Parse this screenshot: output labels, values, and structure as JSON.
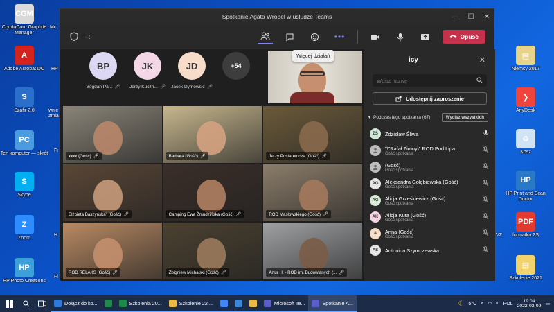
{
  "desktop_left": [
    {
      "label": "CryptoCard Graphite Manager",
      "icon": "cgm-icon",
      "color": "#d9d9d9",
      "text": "CGM"
    },
    {
      "label": "Adobe Acrobat DC",
      "icon": "acrobat-icon",
      "color": "#d4221c",
      "text": "A"
    },
    {
      "label": "Szafir 2.0",
      "icon": "szafir-icon",
      "color": "#2a6fc9",
      "text": "S"
    },
    {
      "label": "Ten komputer — skrót",
      "icon": "computer-icon",
      "color": "#4b9be0",
      "text": "PC"
    },
    {
      "label": "Skype",
      "icon": "skype-icon",
      "color": "#00aff0",
      "text": "S"
    },
    {
      "label": "Zoom",
      "icon": "zoom-icon",
      "color": "#2d8cff",
      "text": "Z"
    },
    {
      "label": "HP Photo Creations",
      "icon": "hp-photo-icon",
      "color": "#3ea0d8",
      "text": "HP"
    }
  ],
  "desktop_partial": [
    "Mc",
    "HP",
    "wnic zmia",
    "Fi",
    "H",
    "Fi",
    "V",
    "VZ"
  ],
  "desktop_right": [
    {
      "label": "Niemcy 2017",
      "icon": "archive-icon",
      "color": "#e8d38a",
      "text": "▤"
    },
    {
      "label": "AnyDesk",
      "icon": "anydesk-icon",
      "color": "#ef443b",
      "text": "❯"
    },
    {
      "label": "Kosz",
      "icon": "recycle-bin-icon",
      "color": "#cfe3f5",
      "text": "♻"
    },
    {
      "label": "HP Print and Scan Doctor",
      "icon": "hp-doctor-icon",
      "color": "#2a79c9",
      "text": "HP"
    },
    {
      "label": "formatka ZS",
      "icon": "pdf-icon",
      "color": "#e33a2f",
      "text": "PDF"
    },
    {
      "label": "Szkolenie 2021",
      "icon": "folder-zip-icon",
      "color": "#f2d36b",
      "text": "▤"
    }
  ],
  "window": {
    "title": "Spotkanie Agata Wróbel w usłudze Teams",
    "timer": "--:--",
    "leave_label": "Opuść",
    "tooltip": "Więcej działań"
  },
  "pinned": [
    {
      "initials": "BP",
      "name": "Bogdan Pa...",
      "color": "#dcd7f2"
    },
    {
      "initials": "JK",
      "name": "Jerzy Kuczn...",
      "color": "#f4d7e6"
    },
    {
      "initials": "JD",
      "name": "Jacek Dymowski",
      "color": "#f6dcc9"
    },
    {
      "initials": "+54",
      "name": "",
      "color": "#3d3d3d"
    }
  ],
  "tiles": [
    {
      "name": "xxxx (Gość)",
      "bg": "#8a8478"
    },
    {
      "name": "Barbara (Gość)",
      "bg": "#c7b78e"
    },
    {
      "name": "Jerzy Postaremcza (Gość)",
      "bg": "#6b5a3a"
    },
    {
      "name": "Elżbieta Baszyńska\" (Gość)",
      "bg": "#5a4636"
    },
    {
      "name": "Camping Ewa Żmudzińska (Gość)",
      "bg": "#3a2e28"
    },
    {
      "name": "ROD Masłowskiego (Gość)",
      "bg": "#8b7d6a"
    },
    {
      "name": "ROD RELAKS (Gość)",
      "bg": "#b98a63"
    },
    {
      "name": "Zbigniew Michalski (Gość)",
      "bg": "#4b4130"
    },
    {
      "name": "Artur H. - ROD im. Budowlanych (...",
      "bg": "#9fa1a3"
    }
  ],
  "panel": {
    "title": "icy",
    "search_placeholder": "Wpisz nazwę",
    "share_label": "Udostępnij zaproszenie",
    "section_label": "Podczas tego spotkania (67)",
    "mute_all_label": "Wycisz wszystkich",
    "participants": [
      {
        "initials": "ZŚ",
        "name": "Zdzisław Śliwa",
        "role": "",
        "color": "#cfe8d8"
      },
      {
        "initials": "",
        "name": "\"\\\"Rafał Zimny\\\" ROD Pod Lipa...",
        "role": "Gość spotkania",
        "color": "#bdbdbd"
      },
      {
        "initials": "",
        "name": "(Gość)",
        "role": "Gość spotkania",
        "color": "#bdbdbd"
      },
      {
        "initials": "AG",
        "name": "Aleksandra Gołębiewska (Gość)",
        "role": "Gość spotkania",
        "color": "#e4e4e4"
      },
      {
        "initials": "AG",
        "name": "Alicja Grześkiewicz (Gość)",
        "role": "Gość spotkania",
        "color": "#d6ecd5"
      },
      {
        "initials": "AK",
        "name": "Alicja Kuta (Gość)",
        "role": "Gość spotkania",
        "color": "#f5d2e2"
      },
      {
        "initials": "A",
        "name": "Anna (Gość)",
        "role": "Gość spotkania",
        "color": "#f6dcc9"
      },
      {
        "initials": "AS",
        "name": "Antonina Szymczewska",
        "role": "",
        "color": "#e4e4e4"
      }
    ]
  },
  "taskbar": {
    "items": [
      {
        "label": "Dołącz do ko...",
        "color": "#2f7ad8"
      },
      {
        "label": "",
        "color": "#1f8a4c"
      },
      {
        "label": "Szkolenia 20...",
        "color": "#1f8a4c"
      },
      {
        "label": "Szkolenie 22 ...",
        "color": "#e9b84a"
      },
      {
        "label": "",
        "color": "#4285f4"
      },
      {
        "label": "",
        "color": "#3a86d8"
      },
      {
        "label": "",
        "color": "#e9b84a"
      },
      {
        "label": "Microsoft Te...",
        "color": "#5b5fc7"
      },
      {
        "label": "Spotkanie A...",
        "color": "#5b5fc7"
      }
    ],
    "weather": "5°C",
    "lang": "POL",
    "time": "19:04",
    "date": "2022-03-09"
  }
}
